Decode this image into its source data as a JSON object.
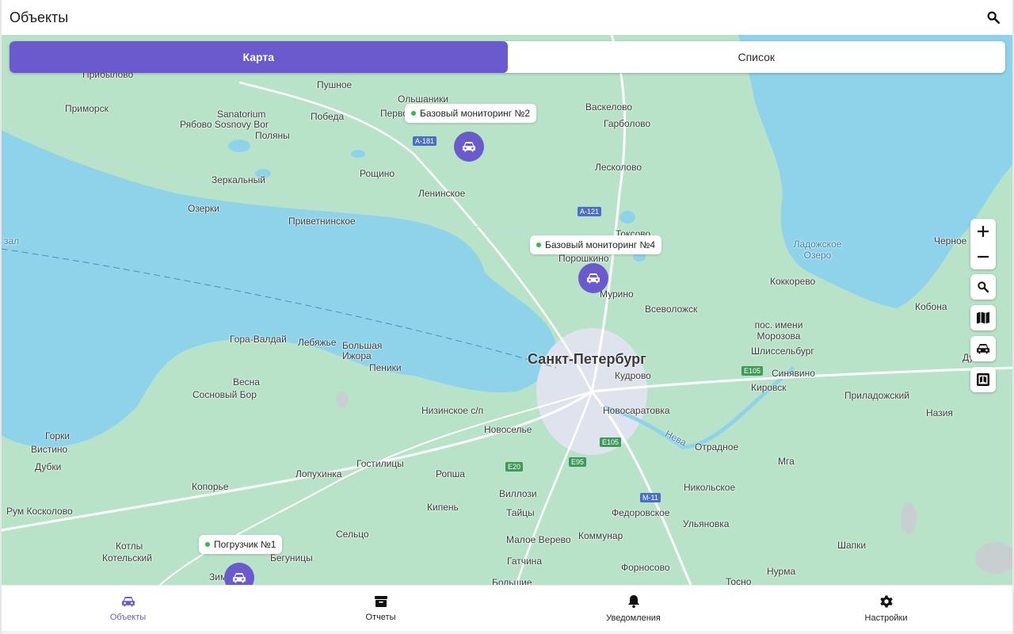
{
  "header": {
    "title": "Объекты",
    "search_icon": "search-icon"
  },
  "segment": {
    "map_label": "Карта",
    "list_label": "Список",
    "active": "map"
  },
  "objects": [
    {
      "label": "Базовый мониторинг №2",
      "status_color": "#2ebd4e"
    },
    {
      "label": "Базовый мониторинг №4",
      "status_color": "#2ebd4e"
    },
    {
      "label": "Погрузчик №1",
      "status_color": "#2ebd4e"
    }
  ],
  "map_places": {
    "city": "Санкт-Петербург",
    "names": [
      "Прибылово",
      "Приморск",
      "Sanatorium",
      "Рябово Sosnovy Bor",
      "Поляны",
      "Зеркальный",
      "Озерки",
      "Пушное",
      "Победа",
      "Ольшаники",
      "Перво",
      "Рощино",
      "Ленинское",
      "Приветнинское",
      "Васкелово",
      "Гарболово",
      "Лесколово",
      "Токсово",
      "Порошкино",
      "Мурино",
      "Всеволожск",
      "Ладожское Озеро",
      "Черное",
      "Коккорево",
      "Кобона",
      "пос. имени Морозова",
      "Шлиссельбург",
      "Синявино",
      "Дубно",
      "Кировск",
      "Приладожский",
      "Назия",
      "Кудрово",
      "Новосаратовка",
      "Отрадное",
      "Мга",
      "Никольское",
      "Ульяновка",
      "Шапки",
      "Нурма",
      "Тосно",
      "Гора-Валдай",
      "Лебяжье",
      "Большая Ижора",
      "Весна",
      "Сосновый Бор",
      "Пеники",
      "Низинское с/п",
      "Новоселье",
      "Горки",
      "Вистино",
      "Дубки",
      "Гостилицы",
      "Лопухинка",
      "Копорье",
      "Ропша",
      "Кипень",
      "Виллози",
      "Тайцы",
      "Федоровское",
      "Коммунар",
      "Малое Верево",
      "Гатчина",
      "Форносово",
      "Большие",
      "Сельцо",
      "Котлы",
      "Котельский",
      "Бегуницы",
      "Зим",
      "Рум Косколово"
    ],
    "water": [
      "Нева",
      "зал"
    ],
    "shields": [
      "A-181",
      "A-121",
      "E105",
      "E105",
      "E95",
      "E20",
      "M-11"
    ]
  },
  "map_controls": {
    "zoom_in": "+",
    "zoom_out": "−",
    "icons": [
      "zoom-in-icon",
      "zoom-out-icon",
      "map-search-icon",
      "map-layers-icon",
      "car-icon",
      "map-legend-icon"
    ]
  },
  "nav": {
    "tabs": [
      {
        "label": "Объекты",
        "icon": "car-icon",
        "active": true
      },
      {
        "label": "Отчеты",
        "icon": "archive-icon",
        "active": false
      },
      {
        "label": "Уведомления",
        "icon": "bell-icon",
        "active": false
      },
      {
        "label": "Настройки",
        "icon": "gear-icon",
        "active": false
      }
    ]
  },
  "colors": {
    "accent": "#6a5acd",
    "water": "#8fd3eb",
    "land": "#b7e0c7",
    "status_online": "#2ebd4e"
  }
}
